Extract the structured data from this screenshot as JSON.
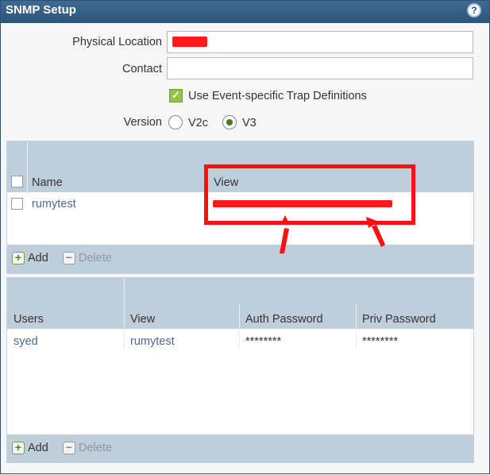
{
  "window": {
    "title": "SNMP Setup",
    "help_icon": "question-circle-icon"
  },
  "form": {
    "physical_location_label": "Physical Location",
    "contact_label": "Contact",
    "use_event_trap_label": "Use Event-specific Trap Definitions",
    "use_event_trap_checked": true,
    "version_label": "Version",
    "version_options": [
      "V2c",
      "V3"
    ],
    "version_selected": "V3"
  },
  "views_table": {
    "columns": [
      "Name",
      "View"
    ],
    "rows": [
      {
        "name": "rumytest",
        "view": ""
      }
    ],
    "add_label": "Add",
    "delete_label": "Delete"
  },
  "users_table": {
    "columns": [
      "Users",
      "View",
      "Auth Password",
      "Priv Password"
    ],
    "rows": [
      {
        "user": "syed",
        "view": "rumytest",
        "auth_password": "********",
        "priv_password": "********"
      }
    ],
    "add_label": "Add",
    "delete_label": "Delete"
  },
  "colors": {
    "title_bar": "#2c5478",
    "header": "#bfcedb",
    "annotation": "#ff1010",
    "check_green": "#8fc447"
  }
}
